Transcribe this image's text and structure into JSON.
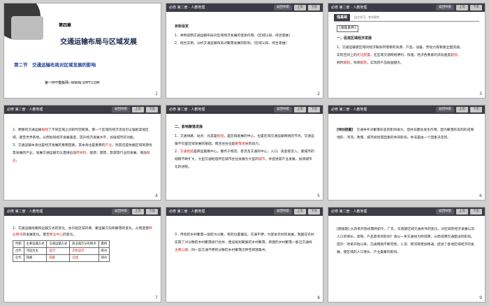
{
  "header": {
    "breadcrumb": "必修 第二册 · 人教地理",
    "nav_buttons": [
      "返回导航",
      "上页",
      "下页"
    ]
  },
  "slide1": {
    "chapter": "第四章",
    "title": "交通运输布局与区域发展",
    "section": "第二节",
    "section_title": "交通运输布局对区域发展的影响",
    "site": "第一PPT模板网--WWW.1PPT.COM",
    "page": "1"
  },
  "slide2": {
    "heading": "目标设定",
    "items": [
      "1．举例说明交通运输布局对区域经济发展的促进作用。(区域认知、综合思维)",
      "2．结合实例，分析交通运输布局对聚落发展的影响。(区域认知、综合思维)"
    ],
    "page": "2"
  },
  "slide3": {
    "tag": "强基础",
    "tag_note": "自主学习、合作探究",
    "box": "[基础素养]",
    "heading": "一、促进区域经济发展",
    "lines": [
      "1．交通运输使区域间经济联系所需要的资源、产品、设备、劳动力等要素全面流通，",
      "实现空间上的",
      "。在区域交通网络便利，快速、经济各要素的流动速度",
      "，",
      "耗时",
      "，效率",
      "，实现的产品收益越大。"
    ],
    "highlights": [
      "优化配置",
      "越快",
      "越短",
      "越高"
    ],
    "page": "3"
  },
  "slide4": {
    "page": "4",
    "p1a": "2．便捷的交通运输",
    "p1h": "缩短",
    "p1b": "了不同区域之间的时空距离，使一个区域的经济活动可以辐射其他区域，甚至世界各地，从而加快经济发展速度，提升经济发展水平，加强城市的功能。",
    "p2a": "3．交通运输本身也是经济发展的重要因素，其本身也是重要的",
    "p2h1": "产业",
    "p2b": "，附其还是依据区域资源优势发展的产业，发展交通运输可以直接拉动",
    "p2h2": "原材料",
    "p2c": "、能源、建筑、旅游等行业的发展，增加",
    "p2h3": "就业",
    "p2d": "。"
  },
  "slide5": {
    "page": "5",
    "heading": "二、影响聚落发展",
    "l1a": "1．交通线路、站点：光其是",
    "l1h1": "枢纽",
    "l1b": "，是区域发展的中心，也是区域交通运输网络的节点。交通运输不仅是区域发展的基础，而且往往也是",
    "l1h2": "聚落发展",
    "l1c": "的动力。",
    "l2a": "2．",
    "l2h1": "交通枢纽",
    "l2b": "是商品集散中心，服务于物流、客流及交通的中心，人口、资金等流入，使城市的规模不断扩大，大型交通枢纽所在城市往往发展为大型的",
    "l2h2": "城市",
    "l2c": "，并促进其产业发展，加快城市化的进程。"
  },
  "slide6": {
    "page": "6",
    "label": "[特别提醒]",
    "text": "交通条件对聚落形态的影响很大，但并非都会发生作用，因为聚落形态的形成受地形、河流、政策、城市规划等因素的共同影响，并非是由一个因素决定的。"
  },
  "slide7": {
    "page": "7",
    "intro_a": "2．交通运输线路和运输方式的变化，会引起区域内商、聚运输方向和聚落的变化，从而促使",
    "intro_h1": "商业网点",
    "intro_b": "的发展变化。甚至",
    "intro_h2": "商业中心",
    "intro_c": "的变化。",
    "table_headers": [
      "时期",
      "主要运输方式",
      "交通运输方式",
      "商业城市分布特点",
      "典例"
    ],
    "rows": [
      [
        "古代",
        "河运为主",
        "京杭运河",
        "扬州"
      ],
      [
        "近代",
        "铁路",
        "京汉铁路",
        "郑州"
      ]
    ],
    "highlights": [
      "运河",
      "沿海",
      "铁路",
      "沿线"
    ],
    "city_extra": "上海"
  },
  "slide8": {
    "page": "8",
    "a": "3．传统的乡村聚落一般较为分散，有的位置偏远，交通不便。为促进农村的发展，我国在农村实施了对分散的乡村聚落进行合并，建设规划聚集的乡村聚落。新建的乡村聚落一般沿交通线",
    "h": "主要公路",
    "b": "，同一些交通不便的分散的乡村聚落迁移至新建集中。"
  },
  "slide9": {
    "page": "9",
    "q": "[随想题] 从改革开放初期到如今，广东，东南部区域交通条件的变化，对区域的经济发展以及人口的增长，高铁、产品等有何影响？请以一条交通线为例说明，从而说明交通建设的影响。",
    "a": "提示：改革开放以来，交通网络不断完善，人流、物流等更加畅通，促进了各地区域经济的发展，使区域的人口增长、产业集聚的影响。"
  }
}
